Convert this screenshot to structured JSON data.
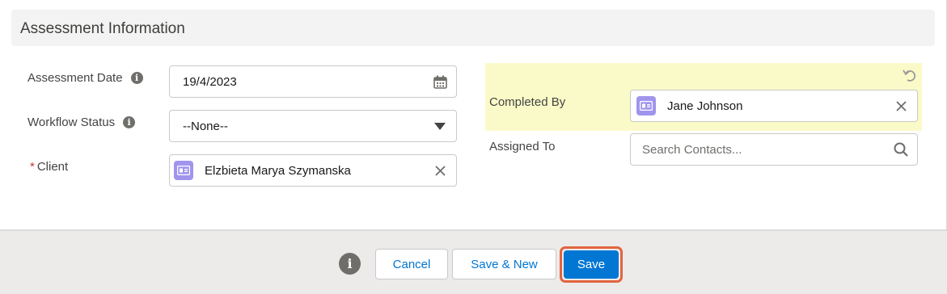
{
  "section": {
    "title": "Assessment Information"
  },
  "fields": {
    "assessment_date": {
      "label": "Assessment Date",
      "value": "19/4/2023"
    },
    "workflow_status": {
      "label": "Workflow Status",
      "value": "--None--"
    },
    "client": {
      "label": "Client",
      "required_marker": "*",
      "value": "Elzbieta Marya Szymanska"
    },
    "completed_by": {
      "label": "Completed By",
      "value": "Jane Johnson"
    },
    "assigned_to": {
      "label": "Assigned To",
      "placeholder": "Search Contacts..."
    }
  },
  "footer": {
    "cancel_label": "Cancel",
    "save_new_label": "Save & New",
    "save_label": "Save"
  },
  "colors": {
    "brand": "#0176d3",
    "highlight": "#fafac8",
    "contact_badge": "#a094ed",
    "focus_outline": "#e2643f",
    "required": "#c23934"
  }
}
